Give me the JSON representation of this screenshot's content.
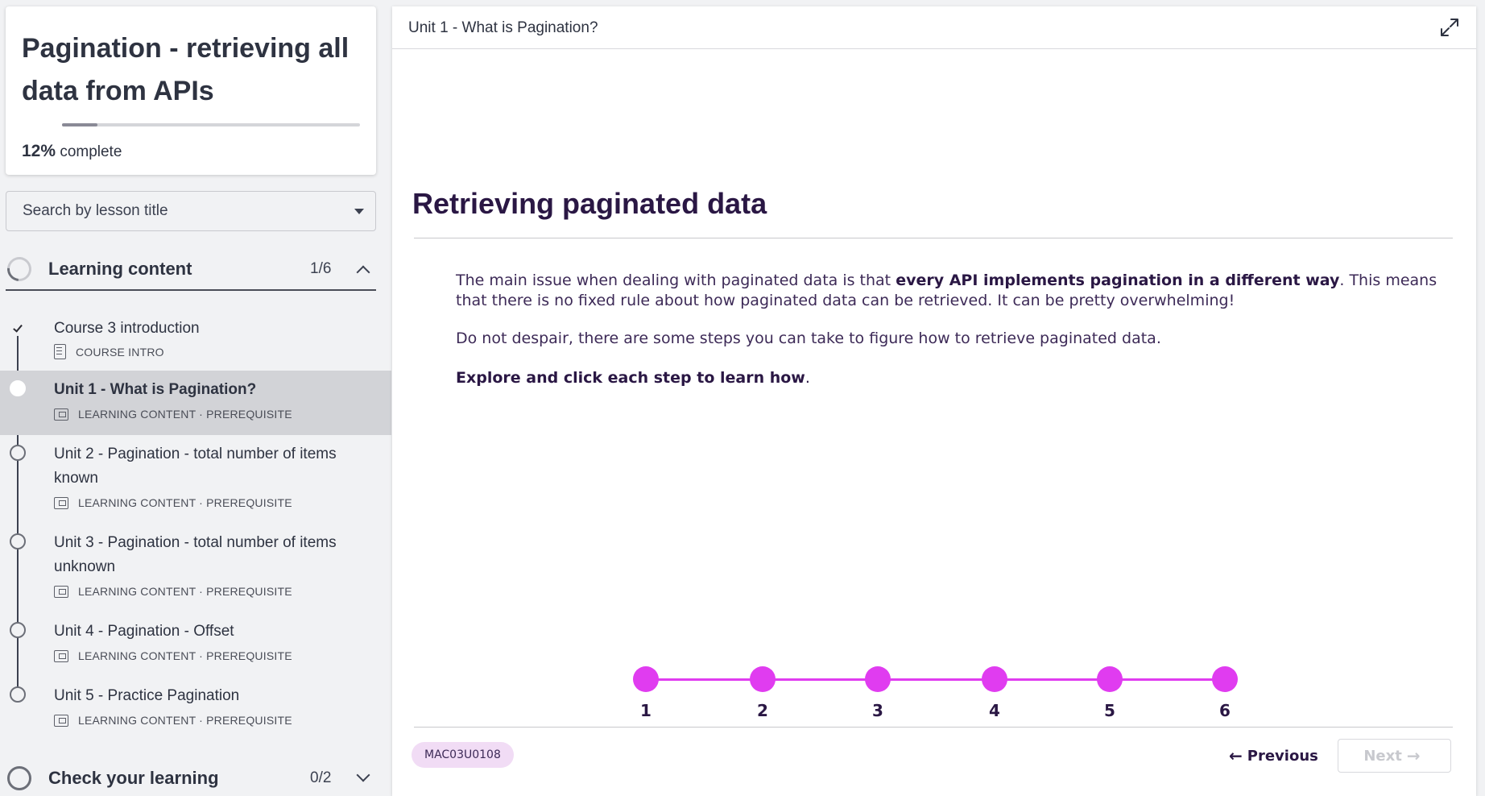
{
  "sidebar": {
    "course": {
      "title": "Pagination - retrieving all data from APIs",
      "progress_value": "12%",
      "progress_fraction": 0.12,
      "progress_suffix": "complete"
    },
    "search": {
      "label": "Search by lesson title"
    },
    "sections": [
      {
        "title": "Learning content",
        "count": "1/6"
      },
      {
        "title": "Check your learning",
        "count": "0/2"
      }
    ],
    "lessons": [
      {
        "title": "Course 3 introduction",
        "meta": "COURSE INTRO",
        "status": "completed"
      },
      {
        "title": "Unit 1 - What is Pagination?",
        "meta": "LEARNING CONTENT · PREREQUISITE",
        "status": "current"
      },
      {
        "title": "Unit 2 - Pagination - total number of items known",
        "meta": "LEARNING CONTENT · PREREQUISITE",
        "status": "not-started"
      },
      {
        "title": "Unit 3 - Pagination - total number of items unknown",
        "meta": "LEARNING CONTENT · PREREQUISITE",
        "status": "not-started"
      },
      {
        "title": "Unit 4 - Pagination - Offset",
        "meta": "LEARNING CONTENT · PREREQUISITE",
        "status": "not-started"
      },
      {
        "title": "Unit 5 - Practice Pagination",
        "meta": "LEARNING CONTENT · PREREQUISITE",
        "status": "not-started"
      }
    ]
  },
  "main": {
    "header_title": "Unit 1 - What is Pagination?",
    "heading": "Retrieving paginated data",
    "paragraph1": {
      "before": "The main issue when dealing with paginated data is that ",
      "bold": "every API implements pagination in a different way",
      "after": ". This means that there is no fixed rule about how paginated data can be retrieved. It can be pretty overwhelming!"
    },
    "paragraph2": "Do not despair, there are some steps you can take to figure how to retrieve paginated data.",
    "paragraph3": {
      "bold": "Explore and click each step to learn how",
      "after": "."
    },
    "steps": [
      "1",
      "2",
      "3",
      "4",
      "5",
      "6"
    ],
    "code": "MAC03U0108",
    "prev_label": "Previous",
    "next_label": "Next"
  },
  "colors": {
    "accent": "#e03cf0",
    "heading": "#2a1744",
    "badge_bg": "#f1dcf5"
  }
}
